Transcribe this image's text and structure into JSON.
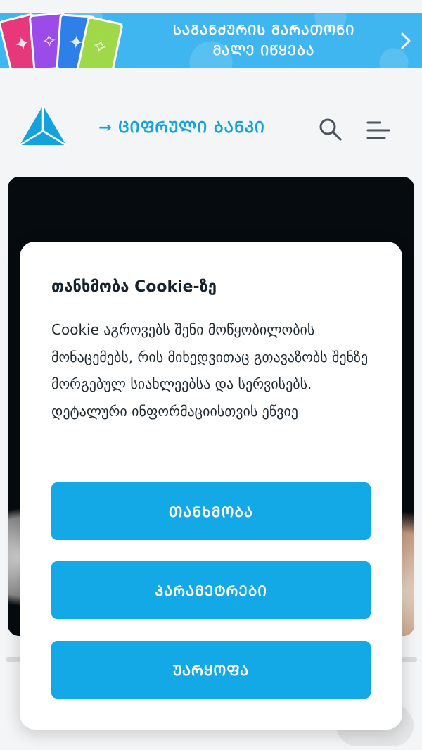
{
  "promo_banner": {
    "line1": "ᲡᲐᲒᲐᲜᲫᲣᲠᲘᲡ ᲛᲐᲠᲐᲗᲝᲜᲘ",
    "line2": "ᲛᲐᲚᲔ ᲘᲬᲧᲔᲑᲐ",
    "arrow_icon": "chevron-right-icon",
    "background_color": "#3fb6f0"
  },
  "header": {
    "digital_bank_link": "→ ᲪᲘᲤᲠᲣᲚᲘ ᲑᲐᲜᲙᲘ",
    "search_icon": "search-icon",
    "menu_icon": "hamburger-menu-icon",
    "accent_color": "#12a3dc"
  },
  "cookie_consent": {
    "title": "თანხმობა Cookie-ზე",
    "body": "Cookie აგროვებს შენი მოწყობილობის მონაცემებს, რის მიხედვითაც გთავაზობს შენზე მორგებულ სიახლეებსა და სერვისებს. დეტალური ინფორმაციისთვის ეწვიე",
    "accept_label": "ᲗᲐᲜᲮᲛᲝᲑᲐ",
    "settings_label": "ᲞᲐᲠᲐᲛᲔᲢᲠᲔᲑᲘ",
    "reject_label": "ᲣᲐᲠᲧᲝᲤᲐ",
    "button_color": "#12a9e6"
  }
}
